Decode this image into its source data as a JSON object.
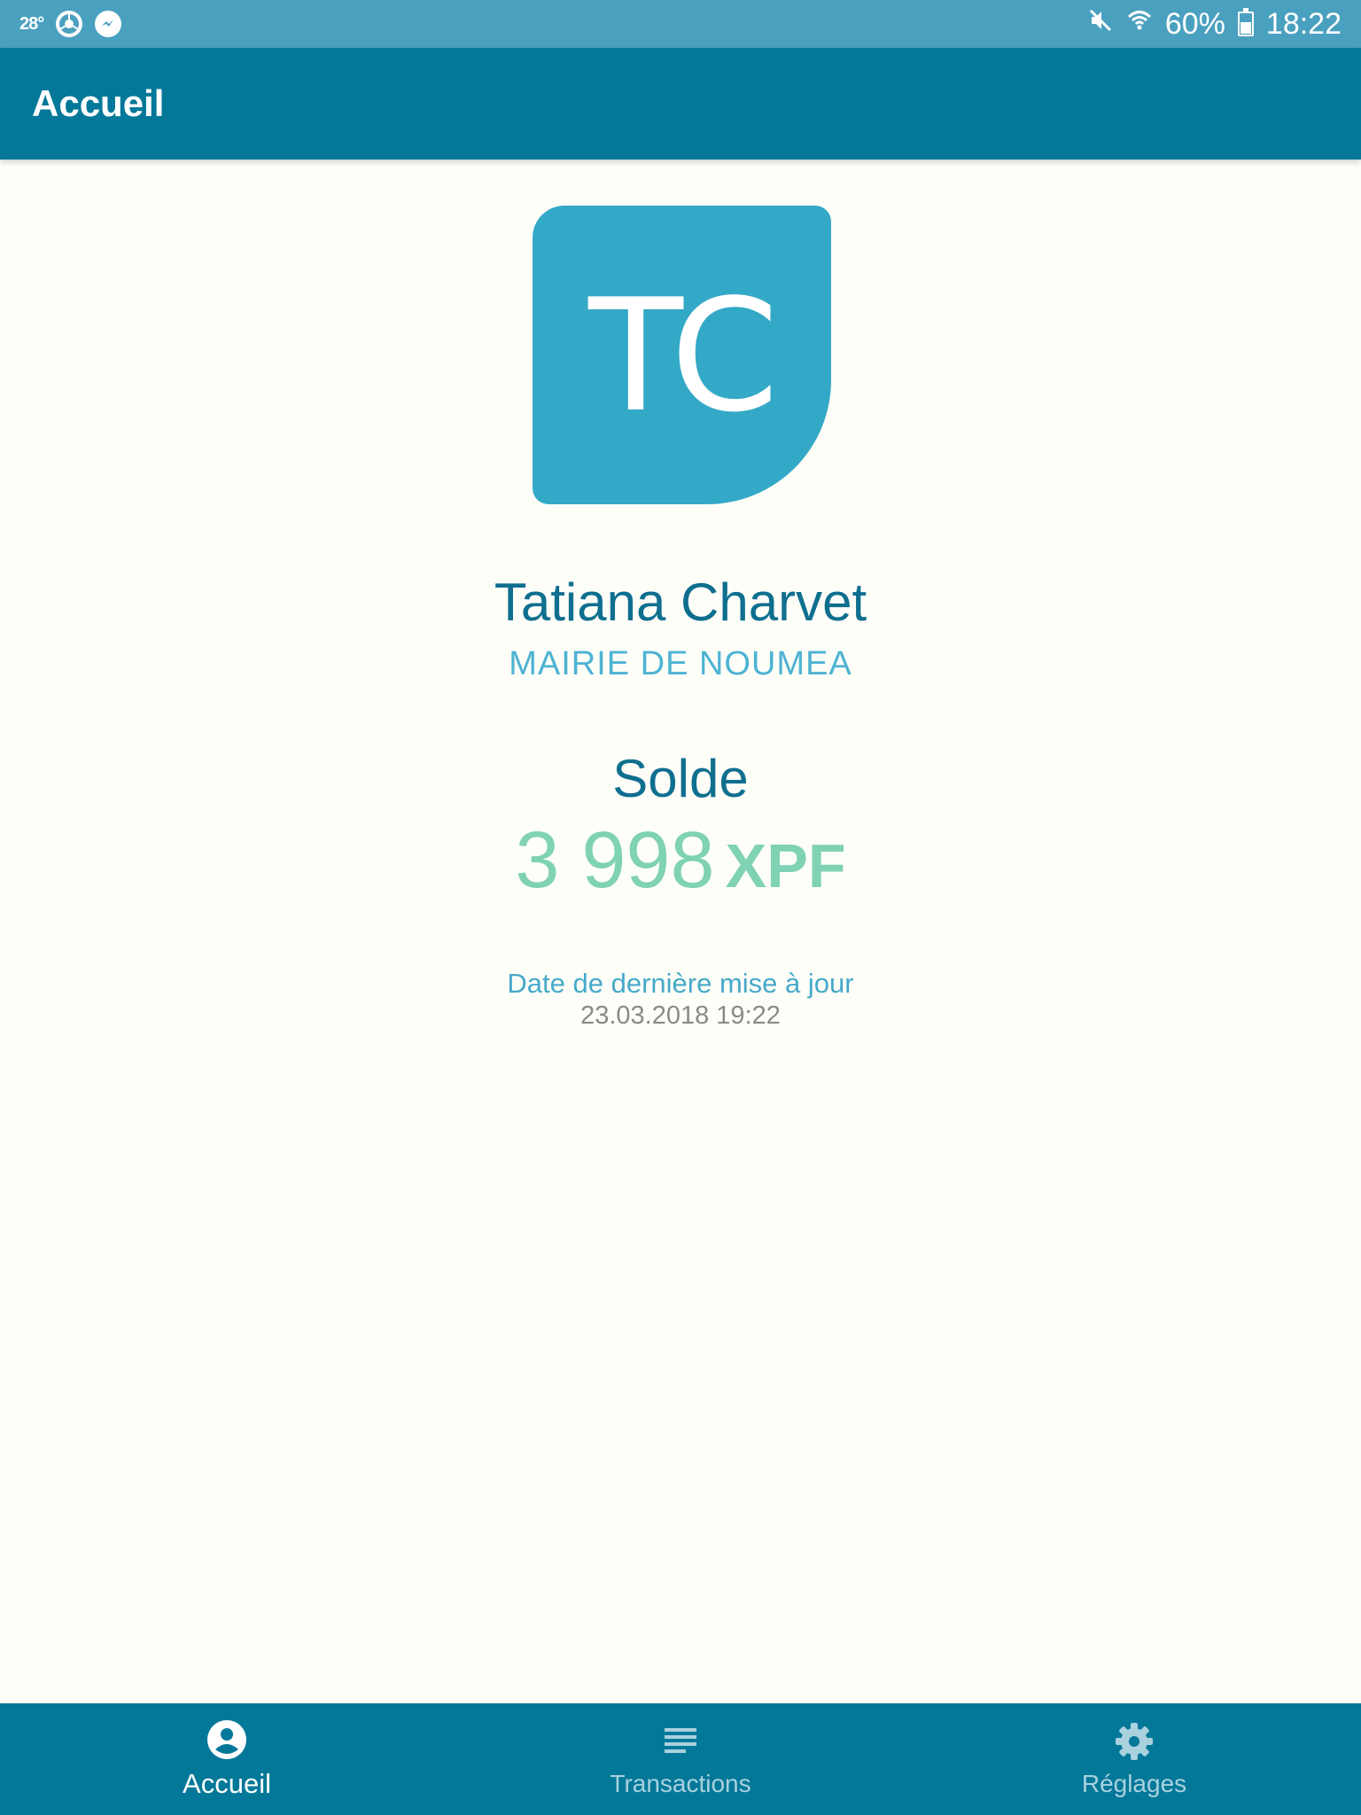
{
  "status_bar": {
    "temperature": "28°",
    "battery": "60%",
    "time": "18:22",
    "icons": [
      "chrome-icon",
      "messenger-icon",
      "mute-icon",
      "wifi-icon",
      "battery-icon"
    ]
  },
  "app_bar": {
    "title": "Accueil"
  },
  "profile": {
    "initials": "TC",
    "name": "Tatiana Charvet",
    "organization": "MAIRIE DE NOUMEA"
  },
  "balance": {
    "label": "Solde",
    "amount": "3 998",
    "currency": "XPF"
  },
  "last_update": {
    "label": "Date de dernière mise à jour",
    "date": "23.03.2018 19:22"
  },
  "bottom_nav": {
    "items": [
      {
        "label": "Accueil",
        "icon": "account-circle-icon",
        "active": true
      },
      {
        "label": "Transactions",
        "icon": "list-icon",
        "active": false
      },
      {
        "label": "Réglages",
        "icon": "gear-icon",
        "active": false
      }
    ]
  },
  "colors": {
    "primary": "#037899",
    "status_bar": "#4aa0bf",
    "avatar": "#33a9c7",
    "balance": "#7fd2b4",
    "name": "#0f6f8f",
    "background": "#fefef9"
  }
}
